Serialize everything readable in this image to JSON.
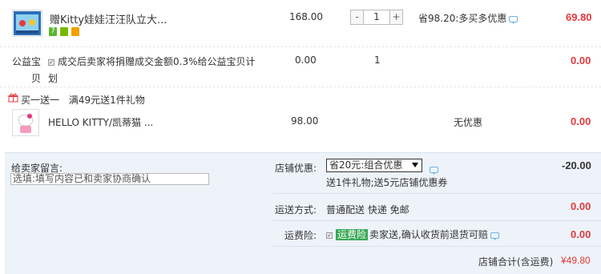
{
  "items": [
    {
      "title": "赠Kitty娃娃汪汪队立大...",
      "unit_price": "168.00",
      "quantity": "1",
      "discount": "省98.20:多买多优惠",
      "subtotal": "69.80",
      "qty_minus": "-",
      "qty_plus": "+",
      "badge_icons": [
        "seven-day-return-icon",
        "guarantee-icon",
        "credit-card-icon"
      ],
      "badge_colors": [
        "#5cb531",
        "#7ab800",
        "#f2a100"
      ]
    },
    {
      "title_line1": "公益宝",
      "title_line2": "贝",
      "desc_line1": "成交后卖家将捐赠成交金额0.3%给公益宝贝计",
      "desc_line2": "划",
      "unit_price": "0.00",
      "quantity": "1",
      "subtotal": "0.00"
    }
  ],
  "promo": {
    "header_label": "买一送一",
    "header_rule": "满49元送1件礼物",
    "gift_title": "HELLO KITTY/凯蒂猫 ...",
    "gift_price": "98.00",
    "gift_discount": "无优惠",
    "gift_subtotal": "0.00"
  },
  "footer": {
    "message_label": "给卖家留言:",
    "message_placeholder": "选填:填写内容已和卖家协商确认",
    "shop_discount_label": "店铺优惠:",
    "shop_discount_value": "省20元:组合优惠",
    "shop_discount_note": "送1件礼物;送5元店铺优惠券",
    "shop_discount_amount": "-20.00",
    "shipping_label": "运送方式:",
    "shipping_value": "普通配送 快递 免邮",
    "shipping_amount": "0.00",
    "insurance_label": "运费险:",
    "insurance_tag": "运费险",
    "insurance_desc": "卖家送,确认收货前退货可赔",
    "insurance_amount": "0.00",
    "total_label": "店铺合计(含运费)",
    "total_value": "¥49.80"
  },
  "colors": {
    "price_red": "#e4393c",
    "footer_bg": "#edf3f9",
    "insurance_tag_bg": "#3aa856"
  }
}
